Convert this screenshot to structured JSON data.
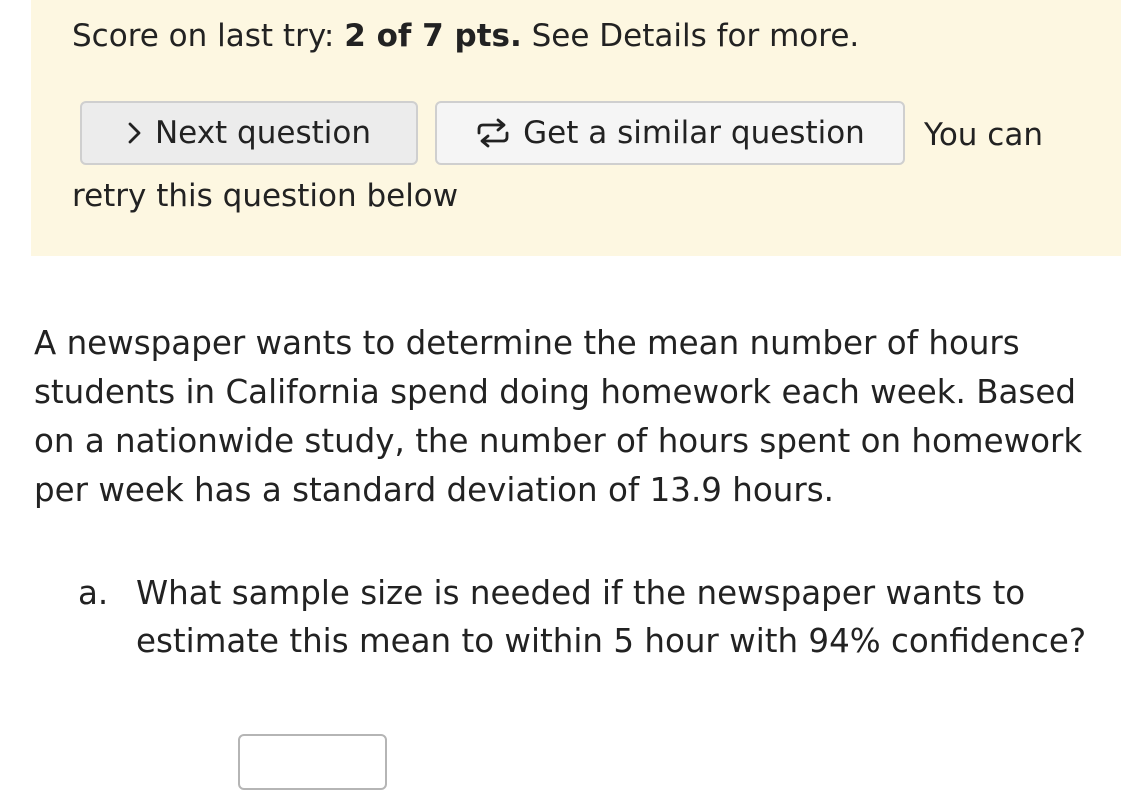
{
  "score": {
    "prefix": "Score on last try: ",
    "value": "2 of 7 pts.",
    "suffix": " See Details for more."
  },
  "buttons": {
    "next_label": "Next question",
    "similar_label": "Get a similar question"
  },
  "retry_note": {
    "line1": "You can",
    "line2": "retry this question below"
  },
  "question": {
    "text": "A newspaper wants to determine the mean number of hours students in California spend doing homework each week. Based on a nationwide study, the number of hours spent on homework per week has a standard deviation of 13.9 hours.",
    "parts": [
      {
        "marker": "a.",
        "text": "What sample size is needed if the newspaper wants to estimate this mean to within 5 hour with 94% confidence?",
        "answer_value": ""
      }
    ]
  },
  "colors": {
    "banner_bg": "#fdf7e1",
    "button_bg": "#ececec",
    "text": "#222222"
  },
  "icons": {
    "next": "chevron-right-icon",
    "similar": "repeat-icon"
  }
}
